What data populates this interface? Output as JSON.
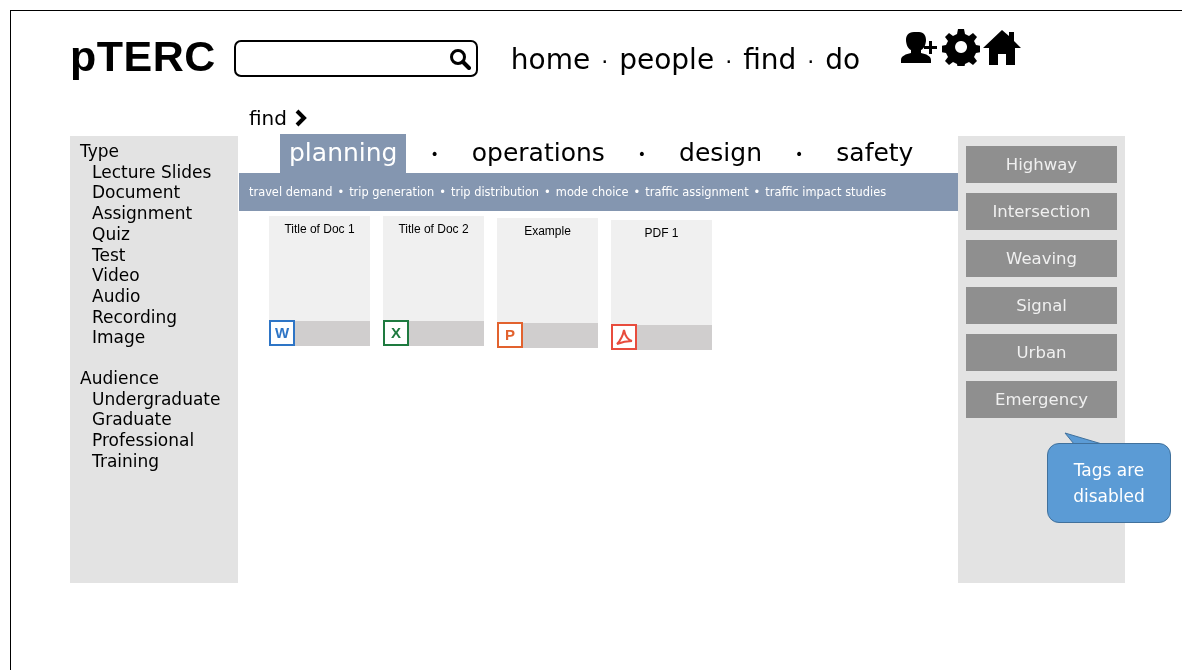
{
  "header": {
    "logo": "pTERC",
    "nav": [
      {
        "label": "home"
      },
      {
        "label": "people"
      },
      {
        "label": "find"
      },
      {
        "label": "do"
      }
    ],
    "nav_separator": "·"
  },
  "breadcrumb": {
    "label": "find"
  },
  "filters": [
    {
      "heading": "Type",
      "items": [
        "Lecture Slides",
        "Document",
        "Assignment",
        "Quiz",
        "Test",
        "Video",
        "Audio",
        "Recording",
        "Image"
      ]
    },
    {
      "heading": "Audience",
      "items": [
        "Undergraduate",
        "Graduate",
        "Professional",
        "Training"
      ]
    }
  ],
  "tabs": [
    {
      "label": "planning",
      "selected": true
    },
    {
      "label": "operations",
      "selected": false
    },
    {
      "label": "design",
      "selected": false
    },
    {
      "label": "safety",
      "selected": false
    }
  ],
  "tab_separator": "•",
  "subtopics": [
    "travel demand",
    "trip generation",
    "trip distribution",
    "mode choice",
    "traffic assignment",
    "traffic impact studies"
  ],
  "subtopic_separator": "•",
  "documents": [
    {
      "title": "Title of Doc 1",
      "kind": "word",
      "letter": "W"
    },
    {
      "title": "Title of Doc 2",
      "kind": "excel",
      "letter": "X"
    },
    {
      "title": "Example",
      "kind": "powerpoint",
      "letter": "P"
    },
    {
      "title": "PDF 1",
      "kind": "pdf"
    }
  ],
  "tags": [
    {
      "label": "Highway",
      "disabled": true
    },
    {
      "label": "Intersection",
      "disabled": true
    },
    {
      "label": "Weaving",
      "disabled": true
    },
    {
      "label": "Signal",
      "disabled": true
    },
    {
      "label": "Urban",
      "disabled": true
    },
    {
      "label": "Emergency",
      "disabled": true
    }
  ],
  "callout": "Tags are disabled"
}
